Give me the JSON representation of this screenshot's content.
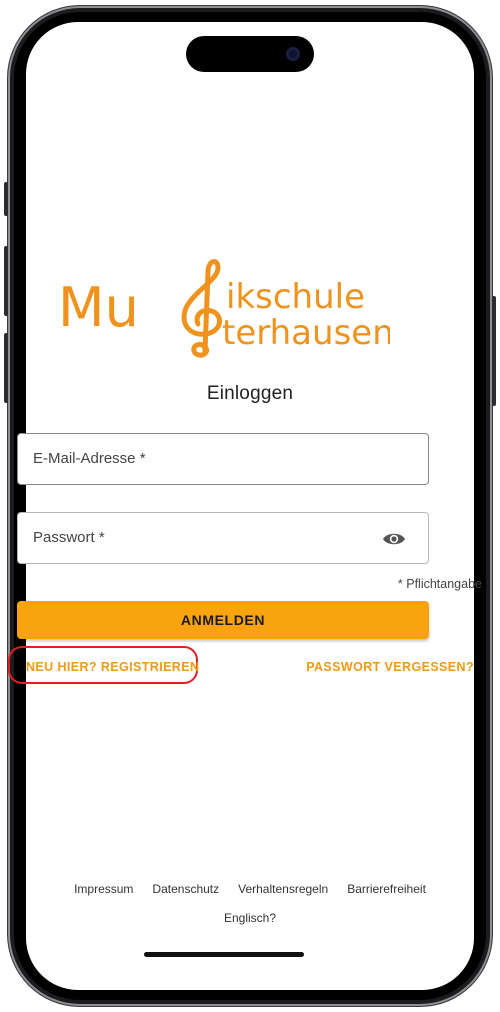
{
  "logo": {
    "line1_prefix": "Mu",
    "line1_rest": "ikschule",
    "line2_rest": "terhausen",
    "color": "#f0931e"
  },
  "heading": "Einloggen",
  "email_field": {
    "label": "E-Mail-Adresse *"
  },
  "password_field": {
    "label": "Passwort *",
    "icon": "eye-icon"
  },
  "required_note": "* Pflichtangabe",
  "login_button": {
    "label": "ANMELDEN",
    "color": "#f9a30f"
  },
  "register_link": "NEU HIER? REGISTRIEREN",
  "forgot_link": "PASSWORT VERGESSEN?",
  "footer": {
    "links": [
      "Impressum",
      "Datenschutz",
      "Verhaltensregeln",
      "Barrierefreiheit"
    ],
    "language": "Englisch?"
  },
  "accent_color": "#f29a14",
  "highlight_color": "#e02020"
}
